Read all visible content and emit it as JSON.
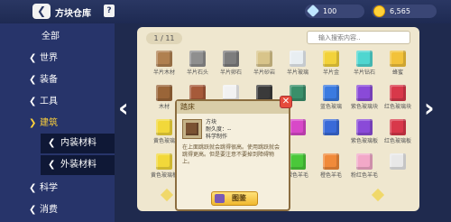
{
  "header": {
    "back_icon": "back-arrow-icon",
    "title": "方块仓库",
    "help_label": "?",
    "diamonds": "100",
    "coins": "6,565"
  },
  "sidebar": {
    "items": [
      {
        "label": "全部",
        "chevron": ""
      },
      {
        "label": "世界",
        "chevron": "❮"
      },
      {
        "label": "装备",
        "chevron": "❮"
      },
      {
        "label": "工具",
        "chevron": "❮"
      },
      {
        "label": "建筑",
        "chevron": "❯"
      },
      {
        "label": "内装材料",
        "chevron": "❮"
      },
      {
        "label": "外装材料",
        "chevron": "❮"
      },
      {
        "label": "科学",
        "chevron": "❮"
      },
      {
        "label": "消费",
        "chevron": "❮"
      }
    ]
  },
  "main": {
    "page_indicator": "1 / 11",
    "search_placeholder": "输入搜索内容..",
    "grid": [
      {
        "label": "半片木材",
        "color": "#b08050"
      },
      {
        "label": "半片石头",
        "color": "#8f8f8f"
      },
      {
        "label": "半片卵石",
        "color": "#7d7d7d"
      },
      {
        "label": "半片砂岩",
        "color": "#d8c48a"
      },
      {
        "label": "半片玻璃",
        "color": "#e8eef2"
      },
      {
        "label": "半片金",
        "color": "#f2d23a"
      },
      {
        "label": "半片钻石",
        "color": "#4fd6d0"
      },
      {
        "label": "蜂蜜",
        "color": "#f2c23a"
      },
      {
        "label": "木材",
        "color": "#9a6538"
      },
      {
        "label": "",
        "color": "#a65a3a"
      },
      {
        "label": "",
        "color": "#f2f2f2"
      },
      {
        "label": "",
        "color": "#3a3a3a"
      },
      {
        "label": "",
        "color": "#3a8f6a"
      },
      {
        "label": "蓝色玻璃",
        "color": "#3a7ae0"
      },
      {
        "label": "紫色玻璃块",
        "color": "#8a4ad8"
      },
      {
        "label": "红色玻璃块",
        "color": "#d8384a"
      },
      {
        "label": "黄色玻璃",
        "color": "#f2d83a"
      },
      {
        "label": "",
        "color": "#9cd848"
      },
      {
        "label": "",
        "color": "#48c8d8"
      },
      {
        "label": "",
        "color": "#4a4ad8"
      },
      {
        "label": "",
        "color": "#d848c8"
      },
      {
        "label": "",
        "color": "#3a6ad8"
      },
      {
        "label": "紫色玻璃板",
        "color": "#8a4ad8"
      },
      {
        "label": "红色玻璃板",
        "color": "#d8384a"
      },
      {
        "label": "黄色玻璃板",
        "color": "#f2d83a"
      },
      {
        "label": "",
        "color": "#f0d86a"
      },
      {
        "label": "",
        "color": "#f08a3a"
      },
      {
        "label": "",
        "color": "#c8a86a"
      },
      {
        "label": "绿色羊毛",
        "color": "#4ac83a"
      },
      {
        "label": "橙色羊毛",
        "color": "#f08a3a"
      },
      {
        "label": "粉红色羊毛",
        "color": "#f2a8c8"
      },
      {
        "label": "",
        "color": "#e8e8e8"
      }
    ]
  },
  "popup": {
    "title": "踏床",
    "close_label": "✕",
    "name": "方块",
    "durability": "耐久度：--",
    "category": "科学制作",
    "description": "在上面跳跃就会跳得很高。使用跳跃就会跳得更高。但是要注意不要掉到障碍物上。",
    "button_label": "图鉴"
  }
}
